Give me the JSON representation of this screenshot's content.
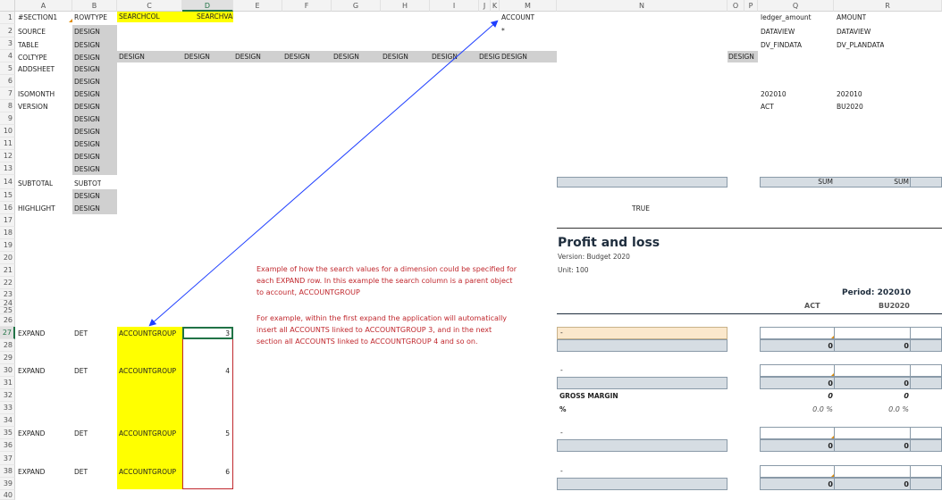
{
  "columns": [
    "A",
    "B",
    "C",
    "D",
    "E",
    "F",
    "G",
    "H",
    "I",
    "J",
    "K",
    "M",
    "N",
    "O",
    "P",
    "Q",
    "R"
  ],
  "rows": [
    "1",
    "2",
    "3",
    "4",
    "5",
    "6",
    "7",
    "8",
    "9",
    "10",
    "11",
    "12",
    "13",
    "14",
    "15",
    "16",
    "17",
    "18",
    "19",
    "20",
    "21",
    "22",
    "23",
    "24",
    "25",
    "26",
    "27",
    "28",
    "29",
    "30",
    "31",
    "32",
    "33",
    "34",
    "35",
    "36",
    "37",
    "38",
    "39",
    "40"
  ],
  "colA": {
    "r1": "#SECTION1",
    "r2": "SOURCE",
    "r3": "TABLE",
    "r4": "COLTYPE",
    "r5": "ADDSHEET",
    "r7": "ISOMONTH",
    "r8": "VERSION",
    "r14": "SUBTOTAL",
    "r16": "HIGHLIGHT",
    "r27": "EXPAND",
    "r30": "EXPAND",
    "r35": "EXPAND",
    "r38": "EXPAND"
  },
  "colB": {
    "r1": "ROWTYPE",
    "design": "DESIGN",
    "r14": "SUBTOT",
    "det": "DET"
  },
  "header": {
    "searchcol": "SEARCHCOL",
    "searchval": "SEARCHVAL"
  },
  "design_label": "DESIGN",
  "design_short": "DESIG",
  "account": {
    "label": "ACCOUNT",
    "star": "*"
  },
  "accountgroup": "ACCOUNTGROUP",
  "expand_values": [
    "3",
    "4",
    "5",
    "6"
  ],
  "colQ": {
    "r1": "ledger_amount",
    "r2": "DATAVIEW",
    "r3": "DV_FINDATA",
    "r7": "202010",
    "r8": "ACT"
  },
  "colR": {
    "r1": "AMOUNT",
    "r2": "DATAVIEW",
    "r3": "DV_PLANDATA",
    "r7": "202010",
    "r8": "BU2020"
  },
  "sum_label": "SUM",
  "true_label": "TRUE",
  "report": {
    "title": "Profit and loss",
    "version": "Version: Budget 2020",
    "unit": "Unit: 100",
    "period": "Period: 202010",
    "act": "ACT",
    "bu": "BU2020",
    "dash": "-",
    "zero": "0",
    "gross_margin": "GROSS MARGIN",
    "pct": "%",
    "pct_value": "0.0 %"
  },
  "note": {
    "line1": "Example of how the search values for a dimension could be specified for",
    "line2": "each EXPAND row. In this example the search column is a parent object",
    "line3": "to account, ACCOUNTGROUP",
    "line4": "For example, within the first expand the application will automatically",
    "line5": "insert all ACCOUNTS linked to ACCOUNTGROUP 3, and in the next",
    "line6": "section all ACCOUNTS linked to ACCOUNTGROUP 4 and so on."
  },
  "colors": {
    "yellow": "#ffff00",
    "design_gray": "#d0d0d0",
    "arrow": "#1f3fff",
    "note_red": "#c0272d",
    "box_fill": "#d6dde3"
  }
}
